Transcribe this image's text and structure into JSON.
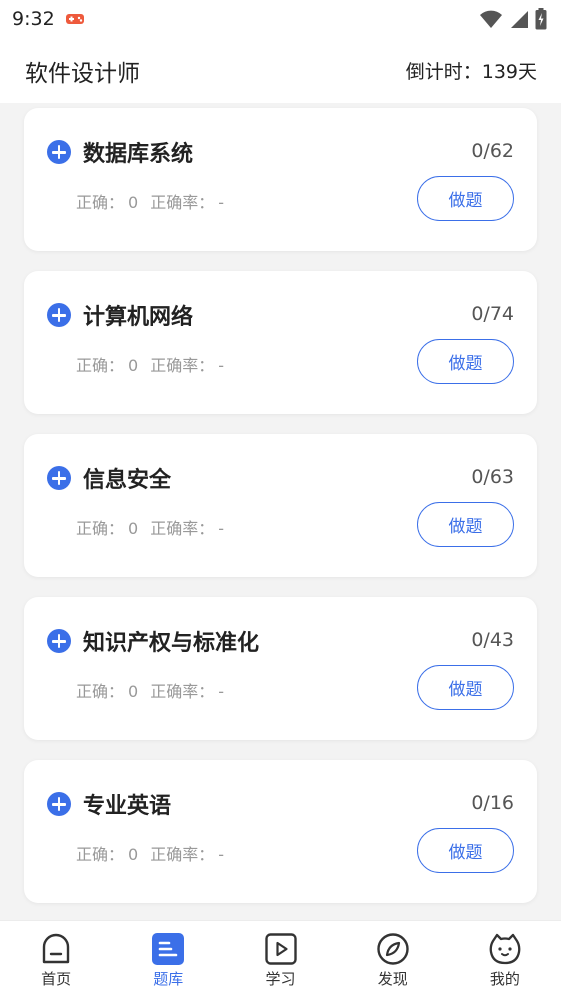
{
  "status_bar": {
    "time": "9:32"
  },
  "header": {
    "title": "软件设计师",
    "countdown": "倒计时：139天"
  },
  "cards": [
    {
      "title": "数据库系统",
      "count": "0/62",
      "correct_label": "正确：",
      "correct_value": "0",
      "rate_label": "正确率：",
      "rate_value": "-",
      "button_label": "做题"
    },
    {
      "title": "计算机网络",
      "count": "0/74",
      "correct_label": "正确：",
      "correct_value": "0",
      "rate_label": "正确率：",
      "rate_value": "-",
      "button_label": "做题"
    },
    {
      "title": "信息安全",
      "count": "0/63",
      "correct_label": "正确：",
      "correct_value": "0",
      "rate_label": "正确率：",
      "rate_value": "-",
      "button_label": "做题"
    },
    {
      "title": "知识产权与标准化",
      "count": "0/43",
      "correct_label": "正确：",
      "correct_value": "0",
      "rate_label": "正确率：",
      "rate_value": "-",
      "button_label": "做题"
    },
    {
      "title": "专业英语",
      "count": "0/16",
      "correct_label": "正确：",
      "correct_value": "0",
      "rate_label": "正确率：",
      "rate_value": "-",
      "button_label": "做题"
    }
  ],
  "tabbar": {
    "items": [
      {
        "label": "首页",
        "icon": "home-icon",
        "active": false
      },
      {
        "label": "题库",
        "icon": "question-bank-icon",
        "active": true
      },
      {
        "label": "学习",
        "icon": "video-play-icon",
        "active": false
      },
      {
        "label": "发现",
        "icon": "compass-icon",
        "active": false
      },
      {
        "label": "我的",
        "icon": "cat-face-icon",
        "active": false
      }
    ]
  },
  "colors": {
    "accent": "#3b6fe8",
    "background": "#f3f3f3",
    "card": "#ffffff",
    "muted_text": "#999999"
  }
}
